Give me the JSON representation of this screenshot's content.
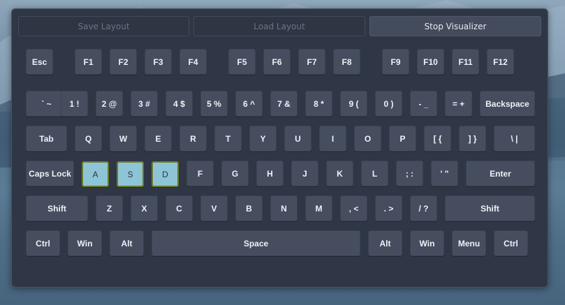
{
  "colors": {
    "panel_bg": "#2f3645",
    "key_bg": "#454d5f",
    "key_highlight": "#8ec5d6",
    "highlight_border": "#6c7a2c",
    "key_text": "#eef1f5"
  },
  "toolbar": {
    "save_label": "Save Layout",
    "load_label": "Load Layout",
    "stop_label": "Stop Visualizer"
  },
  "keyboard": {
    "highlighted_keys": [
      "A",
      "S",
      "D"
    ],
    "rows": [
      [
        "Esc",
        "F1",
        "F2",
        "F3",
        "F4",
        "F5",
        "F6",
        "F7",
        "F8",
        "F9",
        "F10",
        "F11",
        "F12"
      ],
      [
        "` ~",
        "1 !",
        "2 @",
        "3 #",
        "4 $",
        "5 %",
        "6 ^",
        "7 &",
        "8 *",
        "9 (",
        "0 )",
        "- _",
        "= +",
        "Backspace"
      ],
      [
        "Tab",
        "Q",
        "W",
        "E",
        "R",
        "T",
        "Y",
        "U",
        "I",
        "O",
        "P",
        "[ {",
        "] }",
        "\\ |"
      ],
      [
        "Caps Lock",
        "A",
        "S",
        "D",
        "F",
        "G",
        "H",
        "J",
        "K",
        "L",
        "; :",
        "' \"",
        "Enter"
      ],
      [
        "Shift",
        "Z",
        "X",
        "C",
        "V",
        "B",
        "N",
        "M",
        ", <",
        ". >",
        "/ ?",
        "Shift"
      ],
      [
        "Ctrl",
        "Win",
        "Alt",
        "Space",
        "Alt",
        "Win",
        "Menu",
        "Ctrl"
      ]
    ]
  }
}
